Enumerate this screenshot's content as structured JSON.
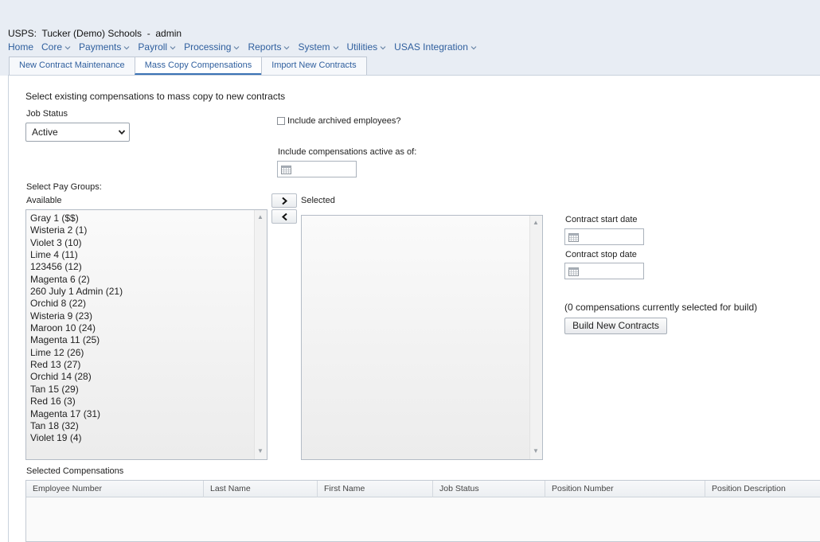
{
  "app": {
    "title": "USPS:  Tucker (Demo) Schools  -  admin"
  },
  "menu": [
    {
      "label": "Home",
      "has_dropdown": false
    },
    {
      "label": "Core",
      "has_dropdown": true
    },
    {
      "label": "Payments",
      "has_dropdown": true
    },
    {
      "label": "Payroll",
      "has_dropdown": true
    },
    {
      "label": "Processing",
      "has_dropdown": true
    },
    {
      "label": "Reports",
      "has_dropdown": true
    },
    {
      "label": "System",
      "has_dropdown": true
    },
    {
      "label": "Utilities",
      "has_dropdown": true
    },
    {
      "label": "USAS Integration",
      "has_dropdown": true
    }
  ],
  "tabs": [
    {
      "label": "New Contract Maintenance",
      "active": false
    },
    {
      "label": "Mass Copy Compensations",
      "active": true
    },
    {
      "label": "Import New Contracts",
      "active": false
    }
  ],
  "form": {
    "heading": "Select existing compensations to mass copy to new contracts",
    "job_status_label": "Job Status",
    "job_status_value": "Active",
    "include_archived_label": "Include archived employees?",
    "include_archived_checked": false,
    "active_as_of_label": "Include compensations active as of:",
    "active_as_of_value": "",
    "pay_groups_label": "Select Pay Groups:",
    "available_label": "Available",
    "selected_label": "Selected",
    "available_items": [
      "Gray 1 ($$)",
      "Wisteria 2 (1)",
      "Violet 3 (10)",
      "Lime 4 (11)",
      "123456 (12)",
      "Magenta 6 (2)",
      "260 July 1 Admin (21)",
      "Orchid 8 (22)",
      "Wisteria 9 (23)",
      "Maroon 10 (24)",
      "Magenta 11 (25)",
      "Lime 12 (26)",
      "Red 13 (27)",
      "Orchid 14 (28)",
      "Tan 15 (29)",
      "Red 16 (3)",
      "Magenta 17 (31)",
      "Tan 18 (32)",
      "Violet 19 (4)"
    ],
    "selected_items": [],
    "contract_start_label": "Contract start date",
    "contract_start_value": "",
    "contract_stop_label": "Contract stop date",
    "contract_stop_value": "",
    "selected_count_text": "(0 compensations currently selected for build)",
    "build_button": "Build New Contracts"
  },
  "compensations": {
    "title": "Selected Compensations",
    "columns": [
      "Employee Number",
      "Last Name",
      "First Name",
      "Job Status",
      "Position Number",
      "Position Description"
    ],
    "rows": []
  },
  "colors": {
    "link": "#2f5f9e",
    "top_band": "#e8edf4",
    "active_tab_underline": "#3b73b5"
  }
}
